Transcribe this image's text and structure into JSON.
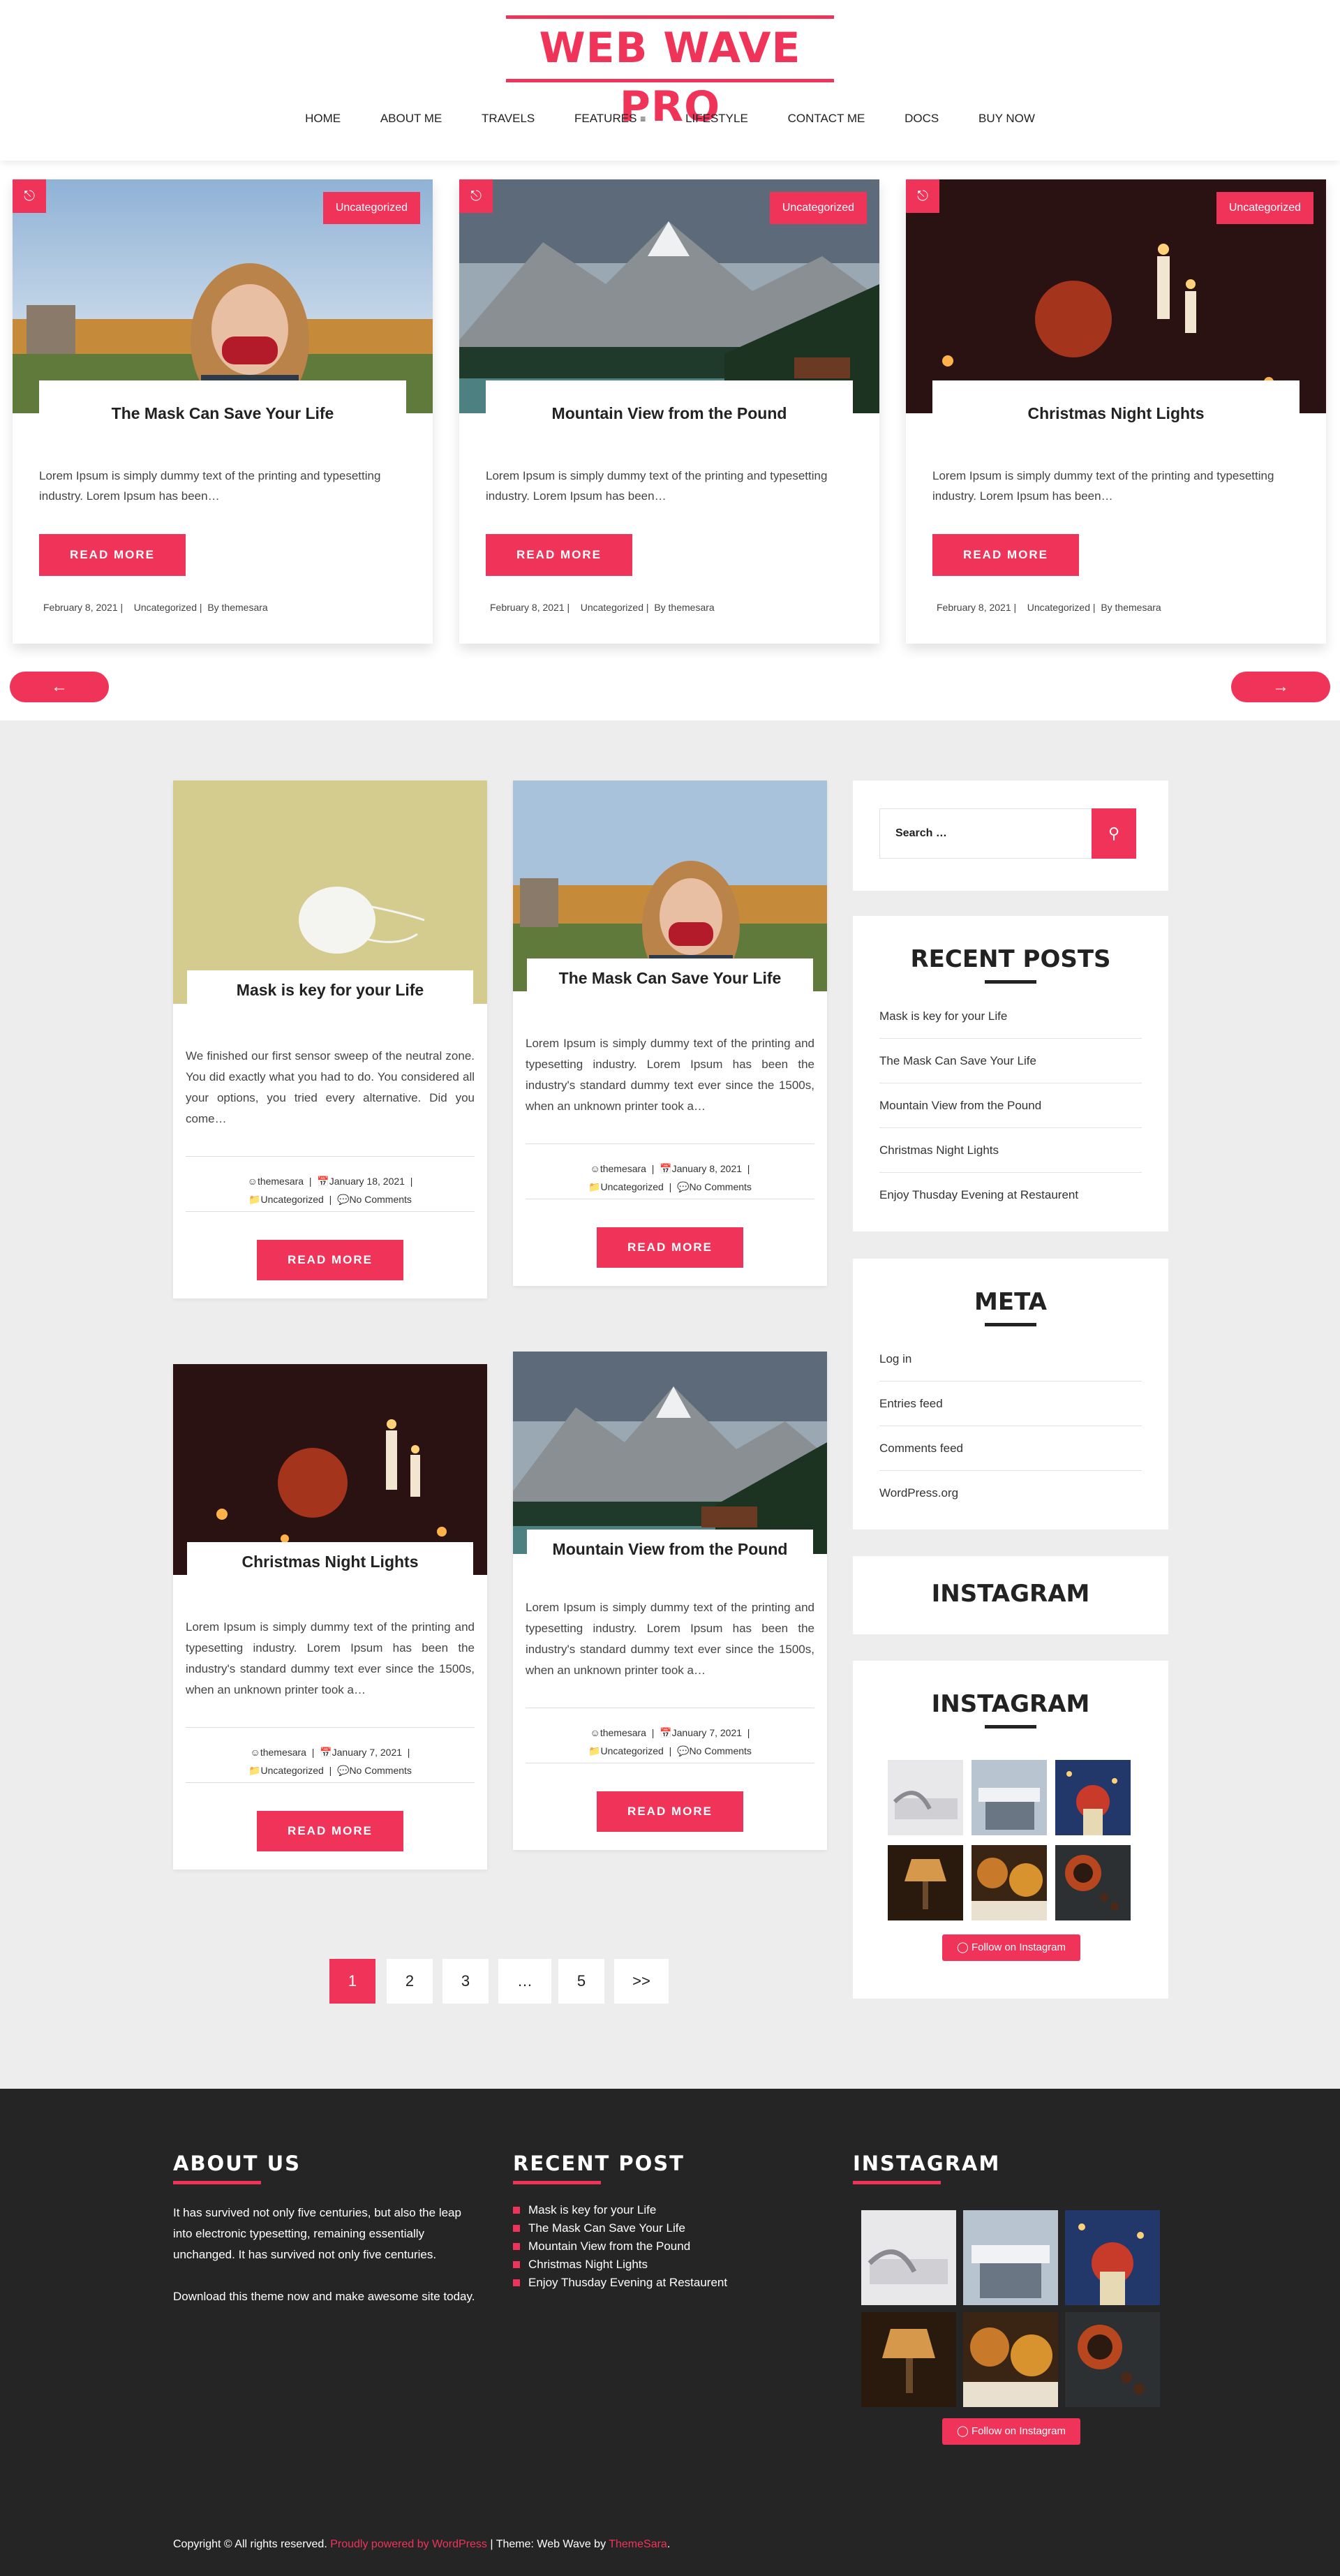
{
  "site": {
    "title": "WEB WAVE PRO"
  },
  "nav": [
    "HOME",
    "ABOUT ME",
    "TRAVELS",
    "FEATURES",
    "LIFESTYLE",
    "CONTACT ME",
    "DOCS",
    "BUY NOW"
  ],
  "slider": [
    {
      "title": "The Mask Can Save Your Life",
      "category": "Uncategorized",
      "excerpt": "Lorem Ipsum is simply dummy text of the printing and typesetting industry. Lorem Ipsum has been…",
      "button": "READ MORE",
      "date": "February 8, 2021",
      "meta_category": "Uncategorized",
      "author": "By themesara"
    },
    {
      "title": "Mountain View from the Pound",
      "category": "Uncategorized",
      "excerpt": "Lorem Ipsum is simply dummy text of the printing and typesetting industry. Lorem Ipsum has been…",
      "button": "READ MORE",
      "date": "February 8, 2021",
      "meta_category": "Uncategorized",
      "author": "By themesara"
    },
    {
      "title": "Christmas Night Lights",
      "category": "Uncategorized",
      "excerpt": "Lorem Ipsum is simply dummy text of the printing and typesetting industry. Lorem Ipsum has been…",
      "button": "READ MORE",
      "date": "February 8, 2021",
      "meta_category": "Uncategorized",
      "author": "By themesara"
    }
  ],
  "posts": [
    {
      "title": "Mask is key for your Life",
      "excerpt": "We finished our first sensor sweep of the neutral zone. You did exactly what you had to do. You considered all your options, you tried every alternative. Did you come…",
      "author": "themesara",
      "date": "January 18, 2021",
      "category": "Uncategorized",
      "comments": "No Comments",
      "button": "READ MORE"
    },
    {
      "title": "The Mask Can Save Your Life",
      "excerpt": "Lorem Ipsum is simply dummy text of the printing and typesetting industry. Lorem Ipsum has been the industry's standard dummy text ever since the 1500s, when an unknown printer took a…",
      "author": "themesara",
      "date": "January 8, 2021",
      "category": "Uncategorized",
      "comments": "No Comments",
      "button": "READ MORE"
    },
    {
      "title": "Christmas Night Lights",
      "excerpt": "Lorem Ipsum is simply dummy text of the printing and typesetting industry. Lorem Ipsum has been the industry's standard dummy text ever since the 1500s, when an unknown printer took a…",
      "author": "themesara",
      "date": "January 7, 2021",
      "category": "Uncategorized",
      "comments": "No Comments",
      "button": "READ MORE"
    },
    {
      "title": "Mountain View from the Pound",
      "excerpt": "Lorem Ipsum is simply dummy text of the printing and typesetting industry. Lorem Ipsum has been the industry's standard dummy text ever since the 1500s, when an unknown printer took a…",
      "author": "themesara",
      "date": "January 7, 2021",
      "category": "Uncategorized",
      "comments": "No Comments",
      "button": "READ MORE"
    }
  ],
  "pagination": [
    "1",
    "2",
    "3",
    "…",
    "5",
    ">>"
  ],
  "sidebar": {
    "search_placeholder": "Search …",
    "recent_title": "RECENT POSTS",
    "recent": [
      "Mask is key for your Life",
      "The Mask Can Save Your Life",
      "Mountain View from the Pound",
      "Christmas Night Lights",
      "Enjoy Thusday Evening at Restaurent"
    ],
    "meta_title": "META",
    "meta": [
      "Log in",
      "Entries feed",
      "Comments feed",
      "WordPress.org"
    ],
    "instagram_title_1": "INSTAGRAM",
    "instagram_title_2": "INSTAGRAM",
    "instagram_button": "Follow on Instagram"
  },
  "footer": {
    "about_title": "ABOUT US",
    "about_text_1": "It has survived not only five centuries, but also the leap into electronic typesetting, remaining essentially unchanged. It has survived not only five centuries.",
    "about_text_2": "Download this theme now and make awesome site today.",
    "recent_title": "RECENT POST",
    "recent": [
      "Mask is key for your Life",
      "The Mask Can Save Your Life",
      "Mountain View from the Pound",
      "Christmas Night Lights",
      "Enjoy Thusday Evening at Restaurent"
    ],
    "instagram_title": "INSTAGRAM",
    "instagram_button": "Follow on Instagram",
    "copyright": "Copyright © All rights reserved.",
    "powered": "Proudly powered by WordPress",
    "theme_text": "| Theme: Web Wave by",
    "theme_author": "ThemeSara",
    "dot": "."
  },
  "colors": {
    "accent": "#f03358",
    "footer_bg": "#252525",
    "main_bg": "#ededed"
  }
}
